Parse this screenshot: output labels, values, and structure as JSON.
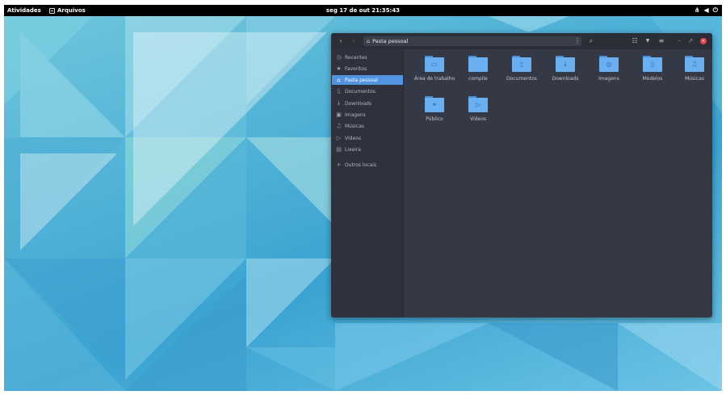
{
  "topbar": {
    "activities": "Atividades",
    "app_name": "Arquivos",
    "clock": "seg 17 de out  21:35:43",
    "tray_icons": [
      "network-icon",
      "volume-icon",
      "power-icon"
    ]
  },
  "window": {
    "path_label": "Pasta pessoal",
    "sidebar": [
      {
        "label": "Recentes",
        "icon": "clock-icon",
        "glyph": "◷"
      },
      {
        "label": "Favoritos",
        "icon": "star-icon",
        "glyph": "★"
      },
      {
        "label": "Pasta pessoal",
        "icon": "home-icon",
        "glyph": "⌂",
        "active": true
      },
      {
        "label": "Documentos",
        "icon": "document-icon",
        "glyph": "▯"
      },
      {
        "label": "Downloads",
        "icon": "download-icon",
        "glyph": "↓"
      },
      {
        "label": "Imagens",
        "icon": "image-icon",
        "glyph": "▣"
      },
      {
        "label": "Músicas",
        "icon": "music-icon",
        "glyph": "♫"
      },
      {
        "label": "Vídeos",
        "icon": "video-icon",
        "glyph": "▷"
      },
      {
        "label": "Lixeira",
        "icon": "trash-icon",
        "glyph": "▤"
      },
      {
        "label": "Outros locais",
        "icon": "plus-icon",
        "glyph": "+"
      }
    ],
    "files": [
      {
        "label": "Área de trabalho",
        "icon": "desktop-folder-icon",
        "glyph": "▭"
      },
      {
        "label": "compile",
        "icon": "folder-icon",
        "glyph": ""
      },
      {
        "label": "Documentos",
        "icon": "documents-folder-icon",
        "glyph": "▯"
      },
      {
        "label": "Downloads",
        "icon": "downloads-folder-icon",
        "glyph": "↓"
      },
      {
        "label": "Imagens",
        "icon": "pictures-folder-icon",
        "glyph": "◎"
      },
      {
        "label": "Modelos",
        "icon": "templates-folder-icon",
        "glyph": "▯"
      },
      {
        "label": "Músicas",
        "icon": "music-folder-icon",
        "glyph": "♫"
      },
      {
        "label": "Público",
        "icon": "public-folder-icon",
        "glyph": "⚭"
      },
      {
        "label": "Vídeos",
        "icon": "videos-folder-icon",
        "glyph": "▷"
      }
    ]
  },
  "colors": {
    "accent": "#5294e2",
    "window_bg": "#353945",
    "sidebar_bg": "#2f323c",
    "headerbar_bg": "#2b2e37",
    "close_button": "#e0464c",
    "folder": "#6ab0f0"
  }
}
